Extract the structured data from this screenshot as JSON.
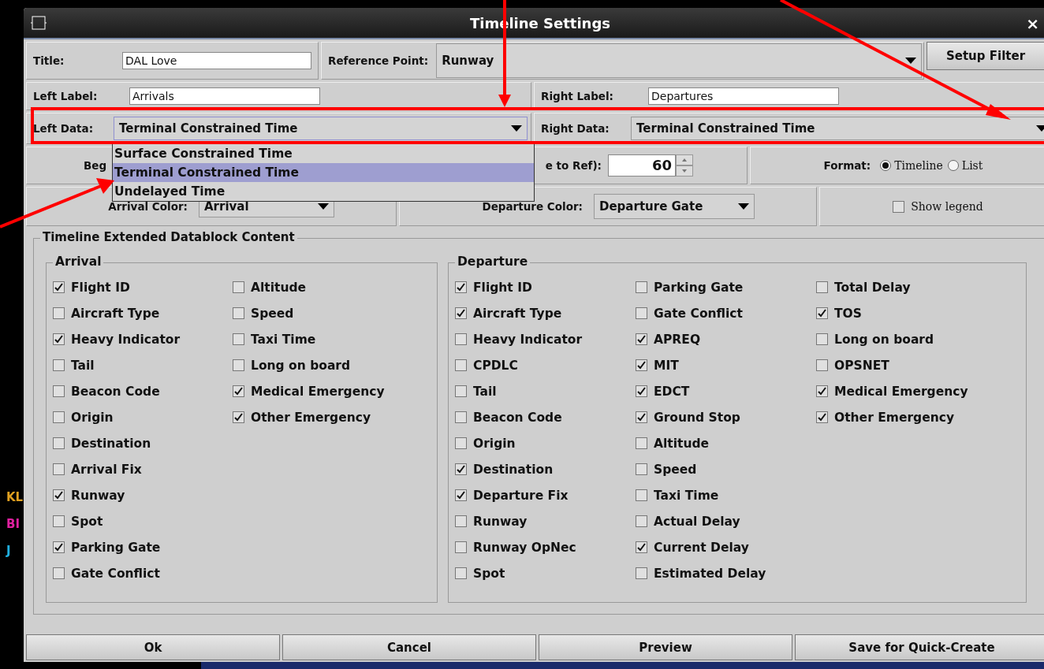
{
  "background_texts": [
    {
      "text": "KL",
      "color": "#e0a020"
    },
    {
      "text": "BI",
      "color": "#e020a0"
    },
    {
      "text": "J",
      "color": "#20b0e0"
    }
  ],
  "window": {
    "title": "Timeline Settings",
    "close": "×"
  },
  "title_field": {
    "label": "Title:",
    "value": "DAL Love"
  },
  "reference_point": {
    "label": "Reference Point:",
    "value": "Runway"
  },
  "setup_filter_button": "Setup Filter",
  "left_label": {
    "label": "Left Label:",
    "value": "Arrivals"
  },
  "right_label": {
    "label": "Right Label:",
    "value": "Departures"
  },
  "left_data": {
    "label": "Left Data:",
    "value": "Terminal Constrained Time",
    "expanded": true,
    "options": [
      {
        "label": "Surface Constrained Time",
        "selected": false
      },
      {
        "label": "Terminal Constrained Time",
        "selected": true
      },
      {
        "label": "Undelayed Time",
        "selected": false
      }
    ]
  },
  "right_data": {
    "label": "Right Data:",
    "value": "Terminal Constrained Time"
  },
  "begin_time": {
    "label_start": "Beg",
    "label_end": "e to Ref):",
    "value": "60"
  },
  "format": {
    "label": "Format:",
    "options": [
      {
        "label": "Timeline",
        "selected": true
      },
      {
        "label": "List",
        "selected": false
      }
    ]
  },
  "arrival_color": {
    "label": "Arrival Color:",
    "value": "Arrival"
  },
  "departure_color": {
    "label": "Departure Color:",
    "value": "Departure Gate"
  },
  "show_legend": {
    "label": "Show legend",
    "checked": false
  },
  "datablock": {
    "title": "Timeline Extended Datablock Content",
    "groups": [
      {
        "title": "Arrival",
        "columns": [
          [
            {
              "label": "Flight ID",
              "checked": true
            },
            {
              "label": "Aircraft Type",
              "checked": false
            },
            {
              "label": "Heavy Indicator",
              "checked": true
            },
            {
              "label": "Tail",
              "checked": false
            },
            {
              "label": "Beacon Code",
              "checked": false
            },
            {
              "label": "Origin",
              "checked": false
            },
            {
              "label": "Destination",
              "checked": false
            },
            {
              "label": "Arrival Fix",
              "checked": false
            },
            {
              "label": "Runway",
              "checked": true
            },
            {
              "label": "Spot",
              "checked": false
            },
            {
              "label": "Parking Gate",
              "checked": true
            },
            {
              "label": "Gate Conflict",
              "checked": false
            }
          ],
          [
            {
              "label": "Altitude",
              "checked": false
            },
            {
              "label": "Speed",
              "checked": false
            },
            {
              "label": "Taxi Time",
              "checked": false
            },
            {
              "label": "Long on board",
              "checked": false
            },
            {
              "label": "Medical Emergency",
              "checked": true
            },
            {
              "label": "Other Emergency",
              "checked": true
            }
          ]
        ]
      },
      {
        "title": "Departure",
        "columns": [
          [
            {
              "label": "Flight ID",
              "checked": true
            },
            {
              "label": "Aircraft Type",
              "checked": true
            },
            {
              "label": "Heavy Indicator",
              "checked": false
            },
            {
              "label": "CPDLC",
              "checked": false
            },
            {
              "label": "Tail",
              "checked": false
            },
            {
              "label": "Beacon Code",
              "checked": false
            },
            {
              "label": "Origin",
              "checked": false
            },
            {
              "label": "Destination",
              "checked": true
            },
            {
              "label": "Departure Fix",
              "checked": true
            },
            {
              "label": "Runway",
              "checked": false
            },
            {
              "label": "Runway OpNec",
              "checked": false
            },
            {
              "label": "Spot",
              "checked": false
            }
          ],
          [
            {
              "label": "Parking Gate",
              "checked": false
            },
            {
              "label": "Gate Conflict",
              "checked": false
            },
            {
              "label": "APREQ",
              "checked": true
            },
            {
              "label": "MIT",
              "checked": true
            },
            {
              "label": "EDCT",
              "checked": true
            },
            {
              "label": "Ground Stop",
              "checked": true
            },
            {
              "label": "Altitude",
              "checked": false
            },
            {
              "label": "Speed",
              "checked": false
            },
            {
              "label": "Taxi Time",
              "checked": false
            },
            {
              "label": "Actual Delay",
              "checked": false
            },
            {
              "label": "Current Delay",
              "checked": true
            },
            {
              "label": "Estimated Delay",
              "checked": false
            }
          ],
          [
            {
              "label": "Total Delay",
              "checked": false
            },
            {
              "label": "TOS",
              "checked": true
            },
            {
              "label": "Long on board",
              "checked": false
            },
            {
              "label": "OPSNET",
              "checked": false
            },
            {
              "label": "Medical Emergency",
              "checked": true
            },
            {
              "label": "Other Emergency",
              "checked": true
            }
          ]
        ]
      }
    ]
  },
  "buttons": [
    "Ok",
    "Cancel",
    "Preview",
    "Save for Quick-Create"
  ]
}
